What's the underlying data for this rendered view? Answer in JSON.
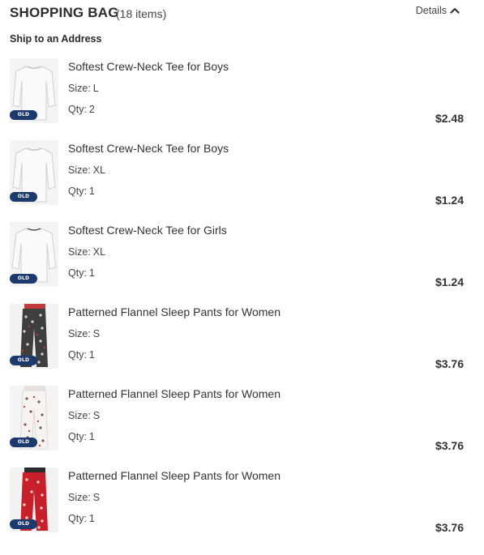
{
  "header": {
    "title": "SHOPPING BAG",
    "count": "(18 items)",
    "details_label": "Details",
    "details_icon": "chevron-up-icon"
  },
  "shipping": {
    "label": "Ship to an Address"
  },
  "labels": {
    "size": "Size:",
    "qty": "Qty:"
  },
  "brand_badge": "OLD NAVY",
  "items": [
    {
      "name": "Softest Crew-Neck Tee for Boys",
      "size": "L",
      "qty": "2",
      "price": "$2.48",
      "image": "white-tee"
    },
    {
      "name": "Softest Crew-Neck Tee for Boys",
      "size": "XL",
      "qty": "1",
      "price": "$1.24",
      "image": "white-tee"
    },
    {
      "name": "Softest Crew-Neck Tee for Girls",
      "size": "XL",
      "qty": "1",
      "price": "$1.24",
      "image": "white-tee"
    },
    {
      "name": "Patterned Flannel Sleep Pants for Women",
      "size": "S",
      "qty": "1",
      "price": "$3.76",
      "image": "gray-pajama-pants"
    },
    {
      "name": "Patterned Flannel Sleep Pants for Women",
      "size": "S",
      "qty": "1",
      "price": "$3.76",
      "image": "white-pajama-pants"
    },
    {
      "name": "Patterned Flannel Sleep Pants for Women",
      "size": "S",
      "qty": "1",
      "price": "$3.76",
      "image": "red-pajama-pants"
    }
  ],
  "colors": {
    "brand_navy": "#1d3a6e",
    "text": "#2b2b2b"
  }
}
